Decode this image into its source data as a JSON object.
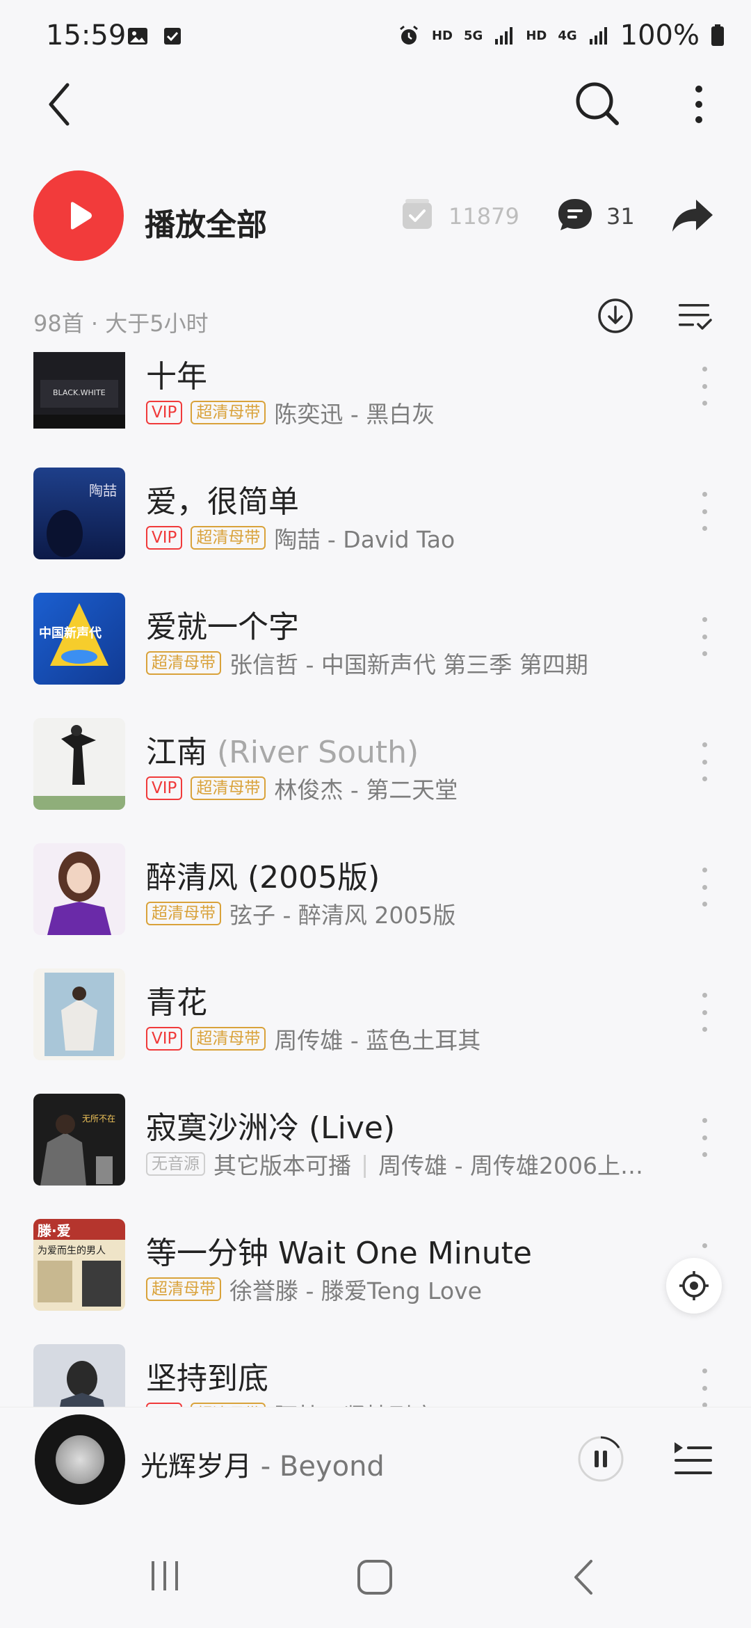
{
  "status_bar": {
    "time": "15:59",
    "indicators": [
      "image-icon",
      "check-square-icon"
    ],
    "network": [
      "HD",
      "5G",
      "HD",
      "4G"
    ],
    "battery": "100%"
  },
  "header": {
    "play_all": "播放全部",
    "collect_count": "11879",
    "comment_count": "31"
  },
  "list_meta": {
    "summary": "98首 · 大于5小时"
  },
  "songs": [
    {
      "title": "十年",
      "alt": "",
      "tags": [
        "VIP",
        "超清母带"
      ],
      "subtitle": "陈奕迅 - 黑白灰"
    },
    {
      "title": "爱，很简单",
      "alt": "",
      "tags": [
        "VIP",
        "超清母带"
      ],
      "subtitle": "陶喆 - David Tao"
    },
    {
      "title": "爱就一个字",
      "alt": "",
      "tags": [
        "超清母带"
      ],
      "subtitle": "张信哲 - 中国新声代 第三季 第四期"
    },
    {
      "title": "江南",
      "alt": "(River South)",
      "tags": [
        "VIP",
        "超清母带"
      ],
      "subtitle": "林俊杰 - 第二天堂"
    },
    {
      "title": "醉清风 (2005版)",
      "alt": "",
      "tags": [
        "超清母带"
      ],
      "subtitle": "弦子 - 醉清风 2005版"
    },
    {
      "title": "青花",
      "alt": "",
      "tags": [
        "VIP",
        "超清母带"
      ],
      "subtitle": "周传雄 - 蓝色土耳其"
    },
    {
      "title": "寂寞沙洲冷 (Live)",
      "alt": "",
      "tags": [
        "无音源"
      ],
      "extra": "其它版本可播",
      "subtitle": "周传雄 - 周传雄2006上…"
    },
    {
      "title": "等一分钟 Wait One Minute",
      "alt": "",
      "tags": [
        "超清母带"
      ],
      "subtitle": "徐誉滕 - 滕爱Teng Love"
    },
    {
      "title": "坚持到底",
      "alt": "",
      "tags": [
        "VIP",
        "超清母带"
      ],
      "subtitle": "阿杜 - 坚持到底"
    }
  ],
  "now_playing": {
    "title": "光辉岁月",
    "separator": " - ",
    "artist": "Beyond"
  },
  "colors": {
    "accent": "#f23b3b",
    "vip": "#f03a3a",
    "hq": "#d9a23a"
  }
}
